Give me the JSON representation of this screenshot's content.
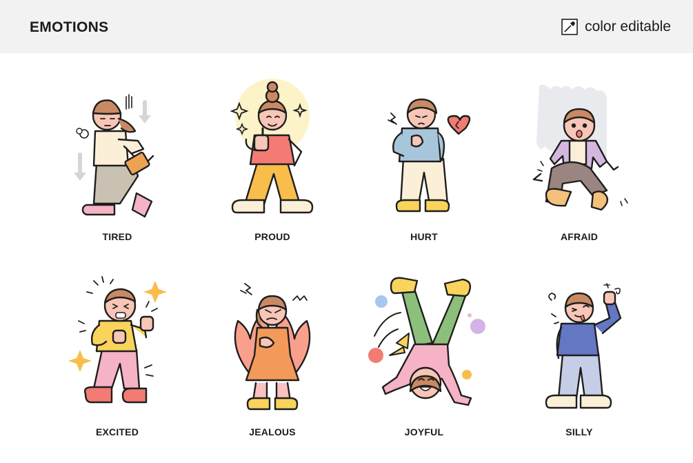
{
  "header": {
    "title": "EMOTIONS",
    "badge_label": "color editable",
    "badge_icon": "eyedropper-icon",
    "background": "#f2f2f2"
  },
  "emotions": [
    {
      "label": "TIRED"
    },
    {
      "label": "PROUD"
    },
    {
      "label": "HURT"
    },
    {
      "label": "AFRAID"
    },
    {
      "label": "EXCITED"
    },
    {
      "label": "JEALOUS"
    },
    {
      "label": "JOYFUL"
    },
    {
      "label": "SILLY"
    }
  ],
  "colors": {
    "outline": "#1e1e1e",
    "skin": "#f7c6b6",
    "hair": "#c98a63"
  }
}
